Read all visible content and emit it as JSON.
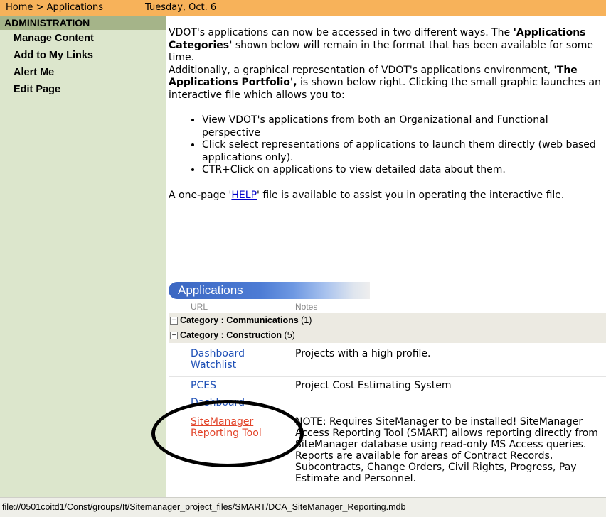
{
  "topbar": {
    "breadcrumb_home": "Home",
    "breadcrumb_sep": " > ",
    "breadcrumb_current": "Applications",
    "date": "Tuesday, Oct. 6"
  },
  "sidebar": {
    "header": "ADMINISTRATION",
    "items": [
      "Manage Content",
      "Add to My Links",
      "Alert Me",
      "Edit Page"
    ]
  },
  "intro": {
    "p1_a": "VDOT's applications can now be accessed in two different ways. The ",
    "p1_b": "'Applications Categories'",
    "p1_c": " shown below will remain in the format that has been available for some time.",
    "p2_a": "Additionally, a graphical representation of VDOT's applications environment, ",
    "p2_b": "'The Applications Portfolio',",
    "p2_c": " is shown below right. Clicking the small graphic launches an interactive file which allows you to:",
    "bullets": [
      "View VDOT's applications from both an Organizational and Functional perspective",
      "Click select representations of applications to launch them directly (web based applications only).",
      "CTR+Click on applications to view detailed data about them."
    ],
    "help_a": "A one-page '",
    "help_link": "HELP",
    "help_b": "' file is available to assist you in operating the interactive file."
  },
  "apps": {
    "header": "Applications",
    "col_url": "URL",
    "col_notes": "Notes",
    "categories": [
      {
        "toggle": "+",
        "label": "Category : Communications",
        "count": "(1)"
      },
      {
        "toggle": "−",
        "label": "Category : Construction",
        "count": "(5)"
      }
    ],
    "rows": [
      {
        "url": "Dashboard Watchlist",
        "note": "Projects with a high profile."
      },
      {
        "url": "PCES",
        "note": "Project Cost Estimating System"
      },
      {
        "url": "Dashboard",
        "note": ""
      },
      {
        "url": "SiteManager Reporting Tool",
        "note": "NOTE: Requires SiteManager to be installed! SiteManager Access Reporting Tool (SMART) allows reporting directly from SiteManager database using read-only MS Access queries. Reports are available for areas of Contract Records, Subcontracts, Change Orders, Civil Rights, Progress, Pay Estimate and Personnel."
      }
    ]
  },
  "statusbar": {
    "text": "file://0501coitd1/Const/groups/It/Sitemanager_project_files/SMART/DCA_SiteManager_Reporting.mdb"
  }
}
